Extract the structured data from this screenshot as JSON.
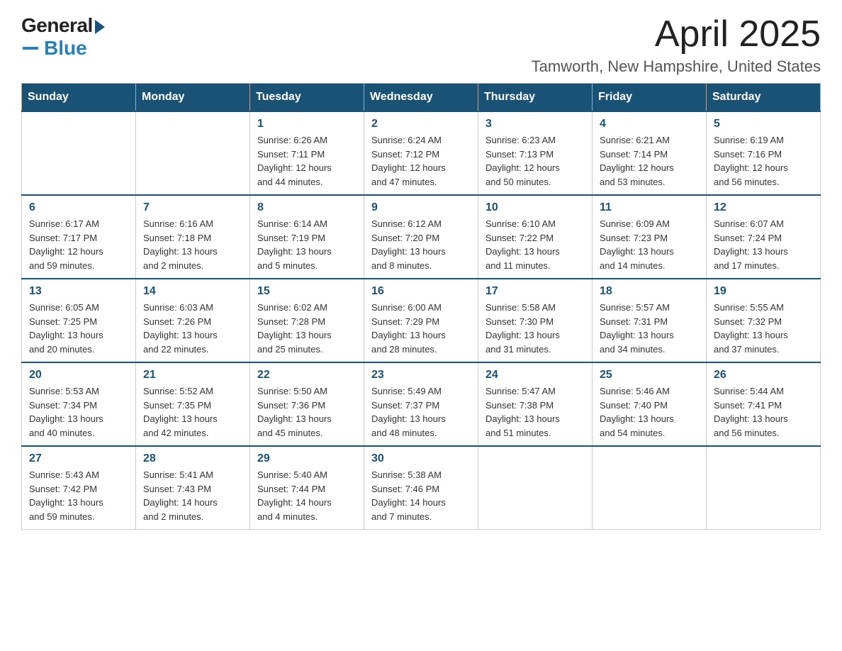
{
  "logo": {
    "general": "General",
    "blue": "Blue",
    "subtitle": "Blue"
  },
  "title": "April 2025",
  "subtitle": "Tamworth, New Hampshire, United States",
  "days_of_week": [
    "Sunday",
    "Monday",
    "Tuesday",
    "Wednesday",
    "Thursday",
    "Friday",
    "Saturday"
  ],
  "weeks": [
    [
      {
        "day": "",
        "info": ""
      },
      {
        "day": "",
        "info": ""
      },
      {
        "day": "1",
        "info": "Sunrise: 6:26 AM\nSunset: 7:11 PM\nDaylight: 12 hours\nand 44 minutes."
      },
      {
        "day": "2",
        "info": "Sunrise: 6:24 AM\nSunset: 7:12 PM\nDaylight: 12 hours\nand 47 minutes."
      },
      {
        "day": "3",
        "info": "Sunrise: 6:23 AM\nSunset: 7:13 PM\nDaylight: 12 hours\nand 50 minutes."
      },
      {
        "day": "4",
        "info": "Sunrise: 6:21 AM\nSunset: 7:14 PM\nDaylight: 12 hours\nand 53 minutes."
      },
      {
        "day": "5",
        "info": "Sunrise: 6:19 AM\nSunset: 7:16 PM\nDaylight: 12 hours\nand 56 minutes."
      }
    ],
    [
      {
        "day": "6",
        "info": "Sunrise: 6:17 AM\nSunset: 7:17 PM\nDaylight: 12 hours\nand 59 minutes."
      },
      {
        "day": "7",
        "info": "Sunrise: 6:16 AM\nSunset: 7:18 PM\nDaylight: 13 hours\nand 2 minutes."
      },
      {
        "day": "8",
        "info": "Sunrise: 6:14 AM\nSunset: 7:19 PM\nDaylight: 13 hours\nand 5 minutes."
      },
      {
        "day": "9",
        "info": "Sunrise: 6:12 AM\nSunset: 7:20 PM\nDaylight: 13 hours\nand 8 minutes."
      },
      {
        "day": "10",
        "info": "Sunrise: 6:10 AM\nSunset: 7:22 PM\nDaylight: 13 hours\nand 11 minutes."
      },
      {
        "day": "11",
        "info": "Sunrise: 6:09 AM\nSunset: 7:23 PM\nDaylight: 13 hours\nand 14 minutes."
      },
      {
        "day": "12",
        "info": "Sunrise: 6:07 AM\nSunset: 7:24 PM\nDaylight: 13 hours\nand 17 minutes."
      }
    ],
    [
      {
        "day": "13",
        "info": "Sunrise: 6:05 AM\nSunset: 7:25 PM\nDaylight: 13 hours\nand 20 minutes."
      },
      {
        "day": "14",
        "info": "Sunrise: 6:03 AM\nSunset: 7:26 PM\nDaylight: 13 hours\nand 22 minutes."
      },
      {
        "day": "15",
        "info": "Sunrise: 6:02 AM\nSunset: 7:28 PM\nDaylight: 13 hours\nand 25 minutes."
      },
      {
        "day": "16",
        "info": "Sunrise: 6:00 AM\nSunset: 7:29 PM\nDaylight: 13 hours\nand 28 minutes."
      },
      {
        "day": "17",
        "info": "Sunrise: 5:58 AM\nSunset: 7:30 PM\nDaylight: 13 hours\nand 31 minutes."
      },
      {
        "day": "18",
        "info": "Sunrise: 5:57 AM\nSunset: 7:31 PM\nDaylight: 13 hours\nand 34 minutes."
      },
      {
        "day": "19",
        "info": "Sunrise: 5:55 AM\nSunset: 7:32 PM\nDaylight: 13 hours\nand 37 minutes."
      }
    ],
    [
      {
        "day": "20",
        "info": "Sunrise: 5:53 AM\nSunset: 7:34 PM\nDaylight: 13 hours\nand 40 minutes."
      },
      {
        "day": "21",
        "info": "Sunrise: 5:52 AM\nSunset: 7:35 PM\nDaylight: 13 hours\nand 42 minutes."
      },
      {
        "day": "22",
        "info": "Sunrise: 5:50 AM\nSunset: 7:36 PM\nDaylight: 13 hours\nand 45 minutes."
      },
      {
        "day": "23",
        "info": "Sunrise: 5:49 AM\nSunset: 7:37 PM\nDaylight: 13 hours\nand 48 minutes."
      },
      {
        "day": "24",
        "info": "Sunrise: 5:47 AM\nSunset: 7:38 PM\nDaylight: 13 hours\nand 51 minutes."
      },
      {
        "day": "25",
        "info": "Sunrise: 5:46 AM\nSunset: 7:40 PM\nDaylight: 13 hours\nand 54 minutes."
      },
      {
        "day": "26",
        "info": "Sunrise: 5:44 AM\nSunset: 7:41 PM\nDaylight: 13 hours\nand 56 minutes."
      }
    ],
    [
      {
        "day": "27",
        "info": "Sunrise: 5:43 AM\nSunset: 7:42 PM\nDaylight: 13 hours\nand 59 minutes."
      },
      {
        "day": "28",
        "info": "Sunrise: 5:41 AM\nSunset: 7:43 PM\nDaylight: 14 hours\nand 2 minutes."
      },
      {
        "day": "29",
        "info": "Sunrise: 5:40 AM\nSunset: 7:44 PM\nDaylight: 14 hours\nand 4 minutes."
      },
      {
        "day": "30",
        "info": "Sunrise: 5:38 AM\nSunset: 7:46 PM\nDaylight: 14 hours\nand 7 minutes."
      },
      {
        "day": "",
        "info": ""
      },
      {
        "day": "",
        "info": ""
      },
      {
        "day": "",
        "info": ""
      }
    ]
  ]
}
